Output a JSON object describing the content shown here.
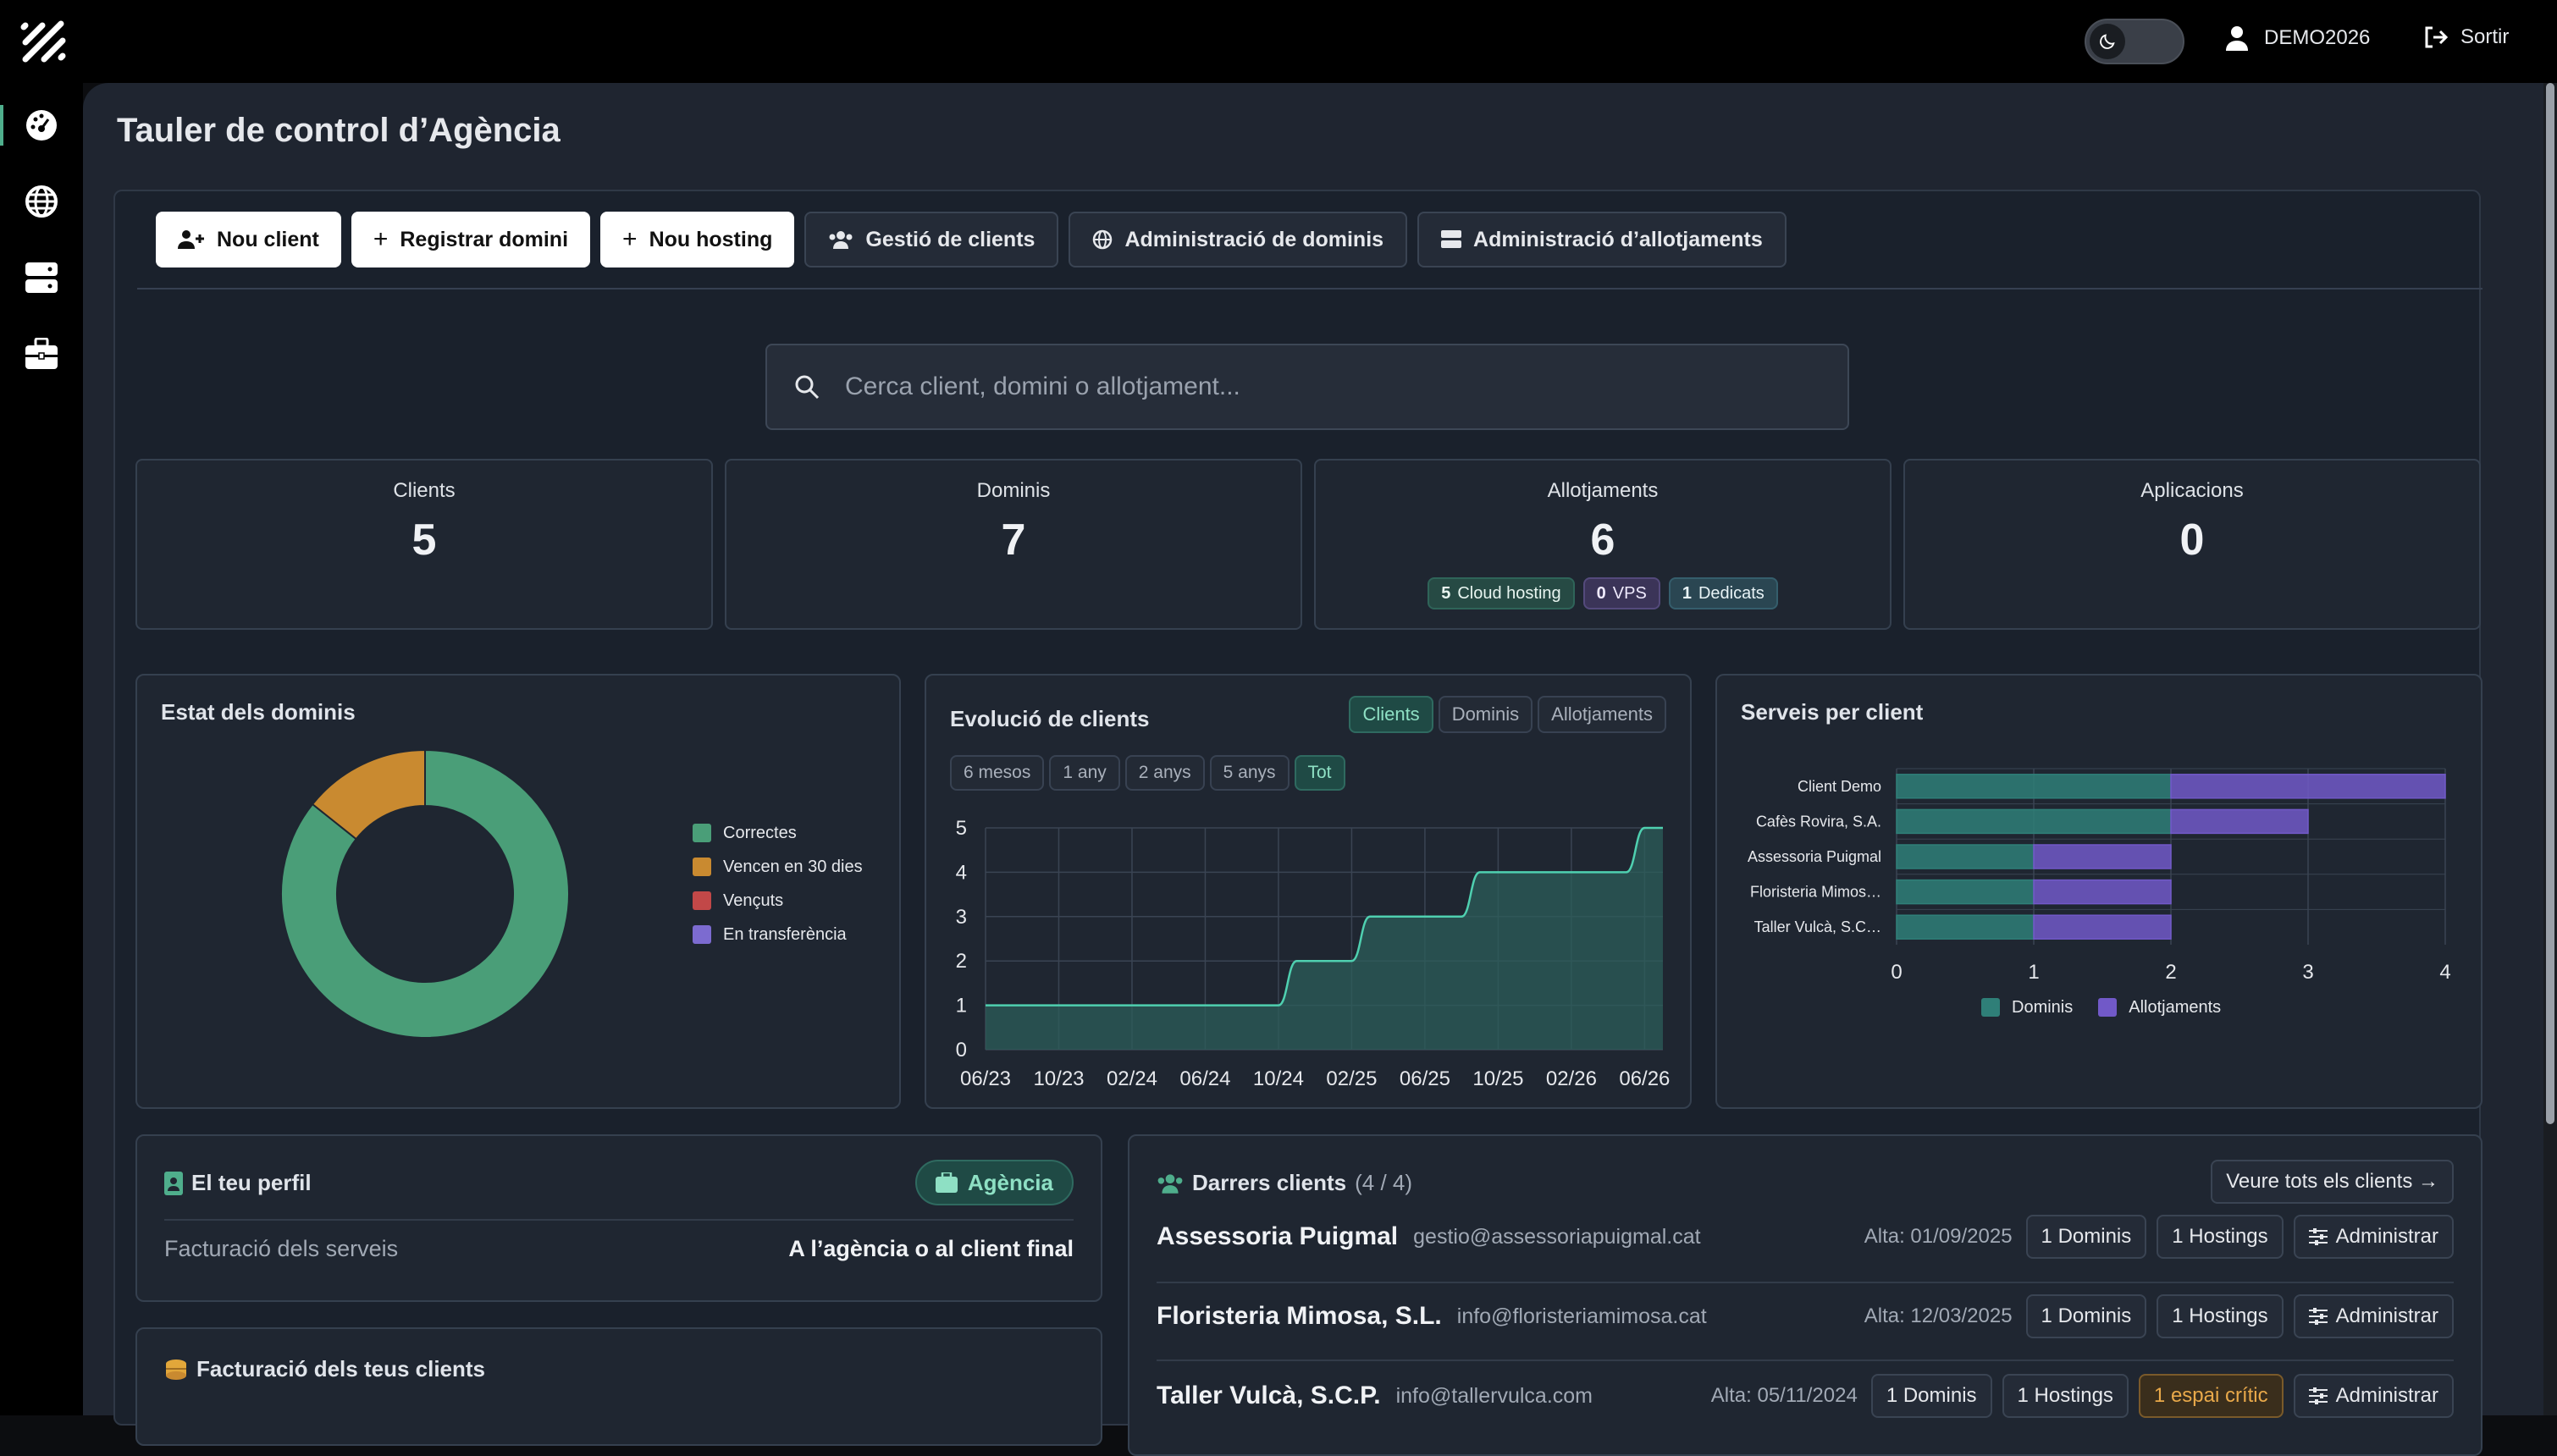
{
  "topbar": {
    "user_name": "DEMO2026",
    "logout_label": "Sortir"
  },
  "sidebar": {
    "items": [
      {
        "icon": "dashboard-icon",
        "active": true
      },
      {
        "icon": "globe-icon",
        "active": false
      },
      {
        "icon": "server-icon",
        "active": false
      },
      {
        "icon": "briefcase-icon",
        "active": false
      }
    ]
  },
  "page": {
    "title": "Tauler de control d’Agència"
  },
  "actions": {
    "new_client": "Nou client",
    "register_domain": "Registrar domini",
    "new_hosting": "Nou hosting",
    "manage_clients": "Gestió de clients",
    "manage_domains": "Administració de dominis",
    "manage_hosting": "Administració d’allotjaments"
  },
  "search": {
    "placeholder": "Cerca client, domini o allotjament..."
  },
  "stats": {
    "clients": {
      "label": "Clients",
      "value": "5"
    },
    "domains": {
      "label": "Dominis",
      "value": "7"
    },
    "hosting": {
      "label": "Allotjaments",
      "value": "6",
      "badges": [
        {
          "count": "5",
          "label": "Cloud hosting"
        },
        {
          "count": "0",
          "label": "VPS"
        },
        {
          "count": "1",
          "label": "Dedicats"
        }
      ]
    },
    "apps": {
      "label": "Aplicacions",
      "value": "0"
    }
  },
  "colors": {
    "accent": "#4fae8c",
    "correct": "#4a9e78",
    "expiring": "#c98a30",
    "expired": "#c24848",
    "transfer": "#7c6bd0",
    "domains_bar": "#2f7f78",
    "hosting_bar": "#7159c8"
  },
  "domain_status": {
    "title": "Estat dels dominis",
    "legend": [
      "Correctes",
      "Vencen en 30 dies",
      "Vençuts",
      "En transferència"
    ]
  },
  "client_evolution": {
    "title": "Evolució de clients",
    "metric_tabs": [
      "Clients",
      "Dominis",
      "Allotjaments"
    ],
    "range_tabs": [
      "6 mesos",
      "1 any",
      "2 anys",
      "5 anys",
      "Tot"
    ]
  },
  "services_per_client": {
    "title": "Serveis per client",
    "legend": [
      "Dominis",
      "Allotjaments"
    ]
  },
  "chart_data": [
    {
      "type": "pie",
      "title": "Estat dels dominis",
      "categories": [
        "Correctes",
        "Vencen en 30 dies",
        "Vençuts",
        "En transferència"
      ],
      "values": [
        6,
        1,
        0,
        0
      ]
    },
    {
      "type": "area",
      "title": "Evolució de clients",
      "x": [
        "06/23",
        "10/23",
        "02/24",
        "06/24",
        "10/24",
        "02/25",
        "06/25",
        "10/25",
        "02/26",
        "06/26"
      ],
      "points": [
        {
          "x": "06/23",
          "y": 1
        },
        {
          "x": "10/24",
          "y": 1
        },
        {
          "x": "11/24",
          "y": 2
        },
        {
          "x": "02/25",
          "y": 2
        },
        {
          "x": "03/25",
          "y": 3
        },
        {
          "x": "08/25",
          "y": 3
        },
        {
          "x": "09/25",
          "y": 4
        },
        {
          "x": "05/26",
          "y": 4
        },
        {
          "x": "06/26",
          "y": 5
        },
        {
          "x": "07/26",
          "y": 5
        }
      ],
      "ylim": [
        0,
        5
      ],
      "yticks": [
        0,
        1,
        2,
        3,
        4,
        5
      ]
    },
    {
      "type": "bar",
      "title": "Serveis per client",
      "orientation": "horizontal",
      "stacked": true,
      "categories": [
        "Client Demo",
        "Cafès Rovira, S.A.",
        "Assessoria Puigmal",
        "Floristeria Mimos…",
        "Taller Vulcà, S.C…"
      ],
      "series": [
        {
          "name": "Dominis",
          "values": [
            2,
            2,
            1,
            1,
            1
          ]
        },
        {
          "name": "Allotjaments",
          "values": [
            2,
            1,
            1,
            1,
            1
          ]
        }
      ],
      "xlim": [
        0,
        4
      ],
      "xticks": [
        0,
        1,
        2,
        3,
        4
      ]
    }
  ],
  "profile": {
    "title": "El teu perfil",
    "badge": "Agència",
    "billing_label": "Facturació dels serveis",
    "billing_value": "A l’agència o al client final"
  },
  "billing": {
    "title": "Facturació dels teus clients"
  },
  "recent_clients": {
    "title": "Darrers clients",
    "count": "(4 / 4)",
    "view_all": "Veure tots els clients →",
    "rows": [
      {
        "name": "Assessoria Puigmal",
        "email": "gestio@assessoriapuigmal.cat",
        "alta": "Alta: 01/09/2025",
        "domains": "1 Dominis",
        "hostings": "1 Hostings",
        "warning": "",
        "admin": "Administrar"
      },
      {
        "name": "Floristeria Mimosa, S.L.",
        "email": "info@floristeriamimosa.cat",
        "alta": "Alta: 12/03/2025",
        "domains": "1 Dominis",
        "hostings": "1 Hostings",
        "warning": "",
        "admin": "Administrar"
      },
      {
        "name": "Taller Vulcà, S.C.P.",
        "email": "info@tallervulca.com",
        "alta": "Alta: 05/11/2024",
        "domains": "1 Dominis",
        "hostings": "1 Hostings",
        "warning": "1 espai crític",
        "admin": "Administrar"
      }
    ]
  }
}
